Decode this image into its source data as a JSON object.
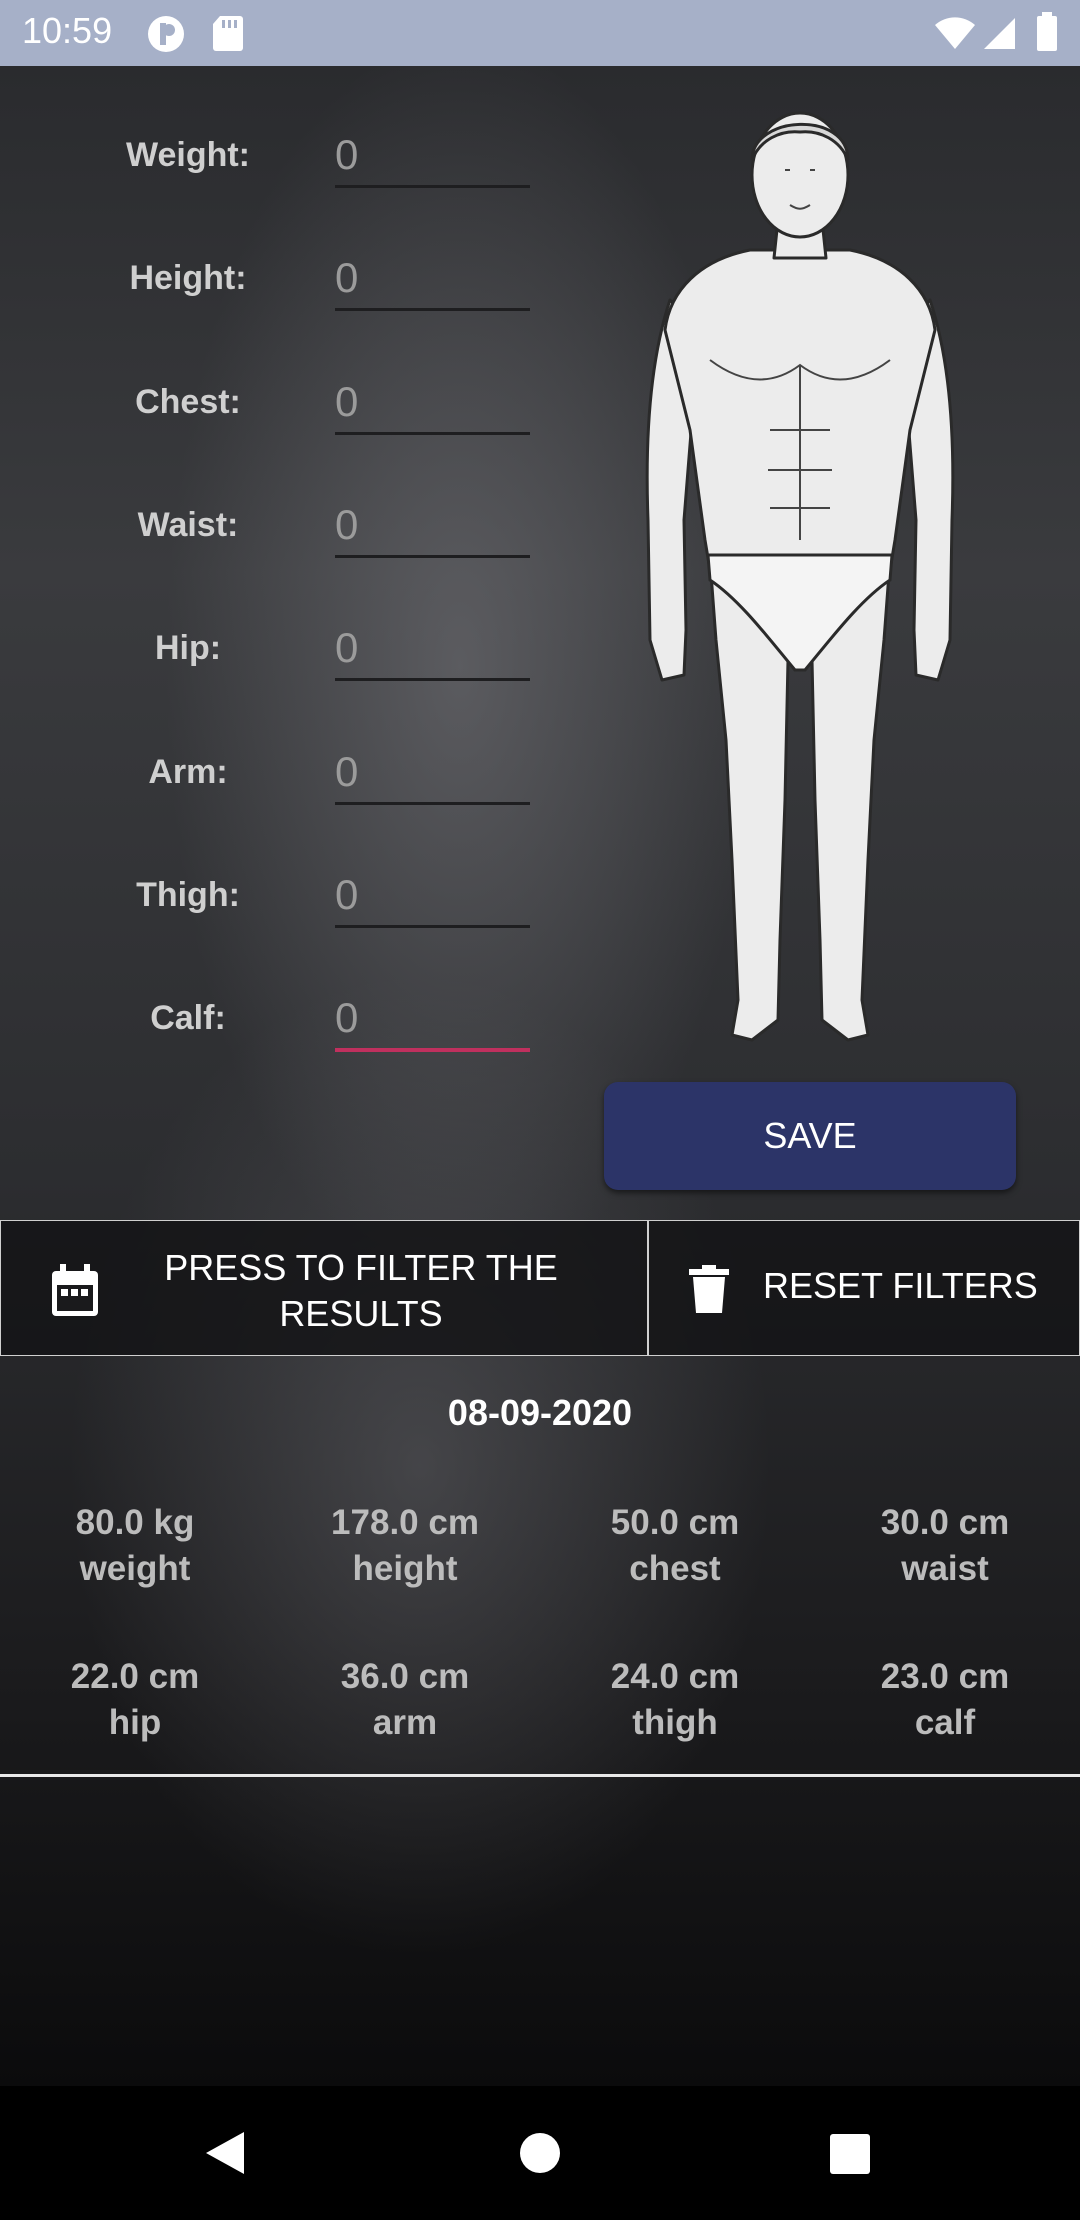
{
  "status_bar": {
    "time": "10:59",
    "icons": [
      "notification-p-icon",
      "sd-card-icon",
      "wifi-icon",
      "cellular-signal-icon",
      "battery-icon"
    ]
  },
  "form": {
    "fields": [
      {
        "label": "Weight:",
        "value": "0"
      },
      {
        "label": "Height:",
        "value": "0"
      },
      {
        "label": "Chest:",
        "value": "0"
      },
      {
        "label": "Waist:",
        "value": "0"
      },
      {
        "label": "Hip:",
        "value": "0"
      },
      {
        "label": "Arm:",
        "value": "0"
      },
      {
        "label": "Thigh:",
        "value": "0"
      },
      {
        "label": "Calf:",
        "value": "0"
      }
    ],
    "save_label": "SAVE"
  },
  "filters": {
    "filter_label": "PRESS TO FILTER THE RESULTS",
    "reset_label": "RESET FILTERS"
  },
  "record": {
    "date": "08-09-2020",
    "entries": [
      {
        "value": "80.0 kg",
        "name": "weight"
      },
      {
        "value": "178.0 cm",
        "name": "height"
      },
      {
        "value": "50.0 cm",
        "name": "chest"
      },
      {
        "value": "30.0 cm",
        "name": "waist"
      },
      {
        "value": "22.0 cm",
        "name": "hip"
      },
      {
        "value": "36.0 cm",
        "name": "arm"
      },
      {
        "value": "24.0 cm",
        "name": "thigh"
      },
      {
        "value": "23.0 cm",
        "name": "calf"
      }
    ]
  },
  "colors": {
    "accent_button": "#2c3468",
    "focus_underline": "#c0305e",
    "status_bar": "#a6b0c8"
  }
}
